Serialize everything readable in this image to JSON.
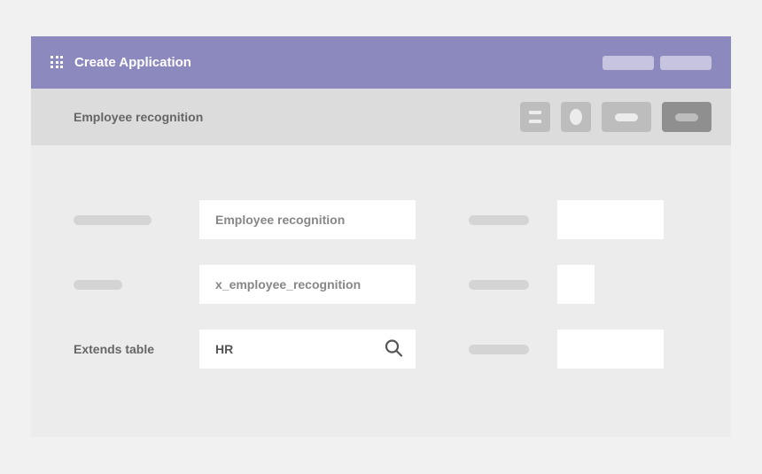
{
  "header": {
    "title": "Create Application"
  },
  "subheader": {
    "title": "Employee recognition"
  },
  "form": {
    "rows": [
      {
        "value": "Employee recognition"
      },
      {
        "value": "x_employee_recognition"
      },
      {
        "label": "Extends table",
        "value": "HR"
      }
    ]
  }
}
